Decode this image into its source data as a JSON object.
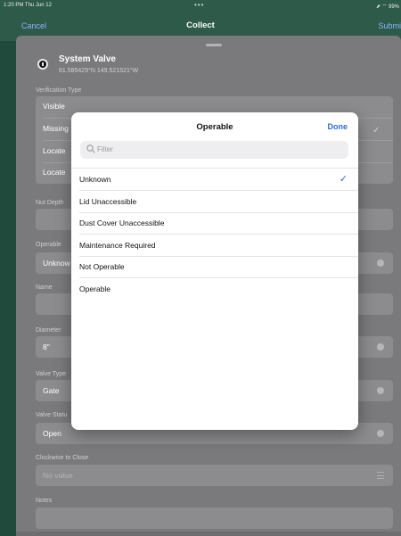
{
  "status_bar": {
    "time": "1:20 PM  Thu Jun 12",
    "dots": "•••",
    "right": "⬈ ⌔ 99%"
  },
  "nav": {
    "cancel": "Cancel",
    "title": "Collect",
    "submit": "Submi"
  },
  "asset": {
    "title": "System Valve",
    "coords": "61.585429°N  149.521521°W"
  },
  "form": {
    "verification_type_label": "Verification Type",
    "verification_rows": [
      "Visible",
      "Missing",
      "Locate",
      "Locate"
    ],
    "nut_depth_label": "Nut Depth",
    "operable_label": "Operable",
    "operable_value": "Unknow",
    "name_label": "Name",
    "diameter_label": "Diameter",
    "diameter_value": "8\"",
    "valve_type_label": "Valve Type",
    "valve_type_value": "Gate",
    "valve_status_label": "Valve Statu",
    "valve_status_value": "Open",
    "clockwise_label": "Clockwise to Close",
    "clockwise_placeholder": "No value",
    "notes_label": "Notes"
  },
  "picker": {
    "title": "Operable",
    "done": "Done",
    "filter_placeholder": "Filter",
    "options": [
      "Unknown",
      "Lid Unaccessible",
      "Dust Cover Unaccessible",
      "Maintenance Required",
      "Not Operable",
      "Operable"
    ],
    "selected_index": 0
  },
  "colors": {
    "accent": "#2f6bd8",
    "nav_bg": "#2e5a4a",
    "sheet_bg": "#7a7a7c"
  }
}
